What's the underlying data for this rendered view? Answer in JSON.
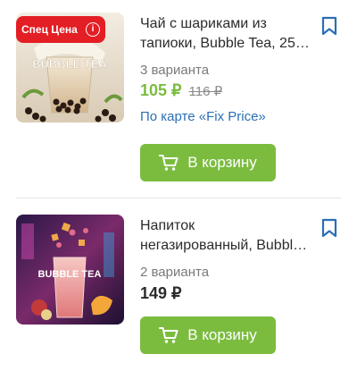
{
  "products": [
    {
      "badge": "Спец Цена",
      "badge_info": "i",
      "title_line1": "Чай с шариками из",
      "title_line2": "тапиоки, Bubble Tea, 25…",
      "variants": "3 варианта",
      "price": "105 ₽",
      "old_price": "116 ₽",
      "card_link": "По карте «Fix Price»",
      "cart_button": "В корзину",
      "image_text": "BUBBLE TEA"
    },
    {
      "title_line1": "Напиток",
      "title_line2": "негазированный, Bubbl…",
      "variants": "2 варианта",
      "price": "149 ₽",
      "cart_button": "В корзину",
      "image_text": "BUBBLE TEA"
    }
  ],
  "colors": {
    "accent_green": "#7bbc3f",
    "badge_red": "#e31e24",
    "link_blue": "#2a6fb5",
    "bookmark_blue": "#2a6fb5"
  },
  "icons": {
    "bookmark": "bookmark-icon",
    "cart": "cart-icon",
    "info": "info-icon"
  }
}
